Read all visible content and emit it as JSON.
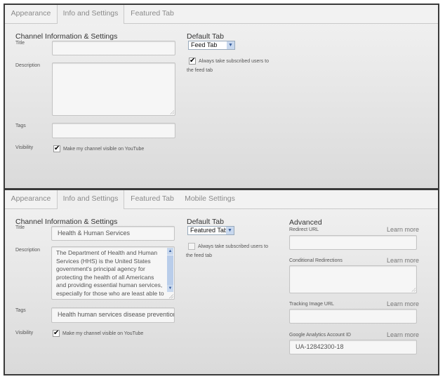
{
  "panel_top": {
    "tabs": [
      {
        "label": "Appearance",
        "active": false
      },
      {
        "label": "Info and Settings",
        "active": true
      },
      {
        "label": "Featured Tab",
        "active": false
      }
    ],
    "section_title": "Channel Information & Settings",
    "title_label": "Title",
    "title_value": "",
    "description_label": "Description",
    "description_value": "",
    "tags_label": "Tags",
    "tags_value": "",
    "visibility_label": "Visibility",
    "visibility_checkbox_label": "Make my channel visible on YouTube",
    "visibility_checked": true,
    "default_tab_title": "Default Tab",
    "default_tab_value": "Feed Tab",
    "always_feed_label_1": "Always take subscribed users to",
    "always_feed_label_2": "the feed tab",
    "always_feed_checked": true
  },
  "panel_bottom": {
    "tabs": [
      {
        "label": "Appearance",
        "active": false
      },
      {
        "label": "Info and Settings",
        "active": true
      },
      {
        "label": "Featured Tab",
        "active": false
      },
      {
        "label": "Mobile Settings",
        "active": false
      }
    ],
    "section_title": "Channel Information & Settings",
    "title_label": "Title",
    "title_value": "Health & Human Services",
    "description_label": "Description",
    "description_value": "The Department of Health and Human Services (HHS) is the United States government's principal agency for protecting the health of all Americans and providing essential human services, especially for those who are least able to help themselves.",
    "tags_label": "Tags",
    "tags_value": "Health human services disease prevention v",
    "visibility_label": "Visibility",
    "visibility_checkbox_label": "Make my channel visible on YouTube",
    "visibility_checked": true,
    "default_tab_title": "Default Tab",
    "default_tab_value": "Featured Tab",
    "always_feed_label_1": "Always take subscribed users to",
    "always_feed_label_2": "the feed tab",
    "always_feed_checked": false,
    "advanced": {
      "title": "Advanced",
      "learn_more": "Learn more",
      "redirect_url_label": "Redirect URL",
      "redirect_url_value": "",
      "conditional_label": "Conditional Redirections",
      "conditional_value": "",
      "tracking_label": "Tracking Image URL",
      "tracking_value": "",
      "ga_label": "Google Analytics Account ID",
      "ga_value": "UA-12842300-18"
    }
  }
}
